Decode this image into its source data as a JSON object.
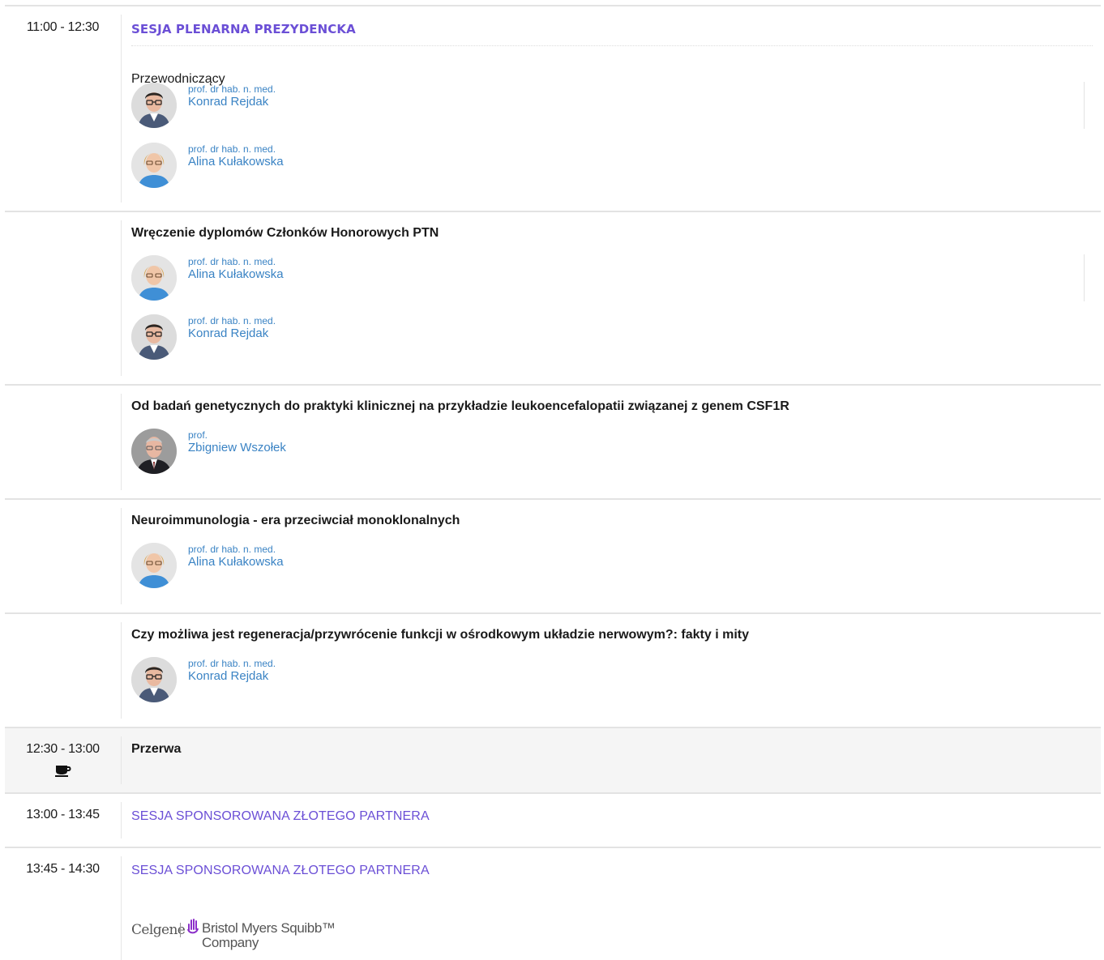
{
  "colors": {
    "session_title": "#6b4fd6",
    "speaker_link": "#3a83c4",
    "divider": "#e3e3e3",
    "break_bg": "#f5f5f5"
  },
  "rows": [
    {
      "time": "11:00 - 12:30",
      "session_title": "SESJA PLENARNA PREZYDENCKA",
      "role_label": "Przewodniczący",
      "speakers": [
        {
          "degree": "prof. dr hab. n. med.",
          "name": "Konrad Rejdak",
          "icon": "avatar-konrad-rejdak"
        },
        {
          "degree": "prof. dr hab. n. med.",
          "name": "Alina Kułakowska",
          "icon": "avatar-alina-kulakowska"
        }
      ]
    },
    {
      "talk_title": "Wręczenie dyplomów Członków Honorowych PTN",
      "speakers": [
        {
          "degree": "prof. dr hab. n. med.",
          "name": "Alina Kułakowska",
          "icon": "avatar-alina-kulakowska"
        },
        {
          "degree": "prof. dr hab. n. med.",
          "name": "Konrad Rejdak",
          "icon": "avatar-konrad-rejdak"
        }
      ]
    },
    {
      "talk_title": "Od badań genetycznych do praktyki klinicznej na przykładzie leukoencefalopatii związanej z genem CSF1R",
      "speakers": [
        {
          "degree": "prof.",
          "name": "Zbigniew Wszołek",
          "icon": "avatar-zbigniew-wszolek"
        }
      ]
    },
    {
      "talk_title": "Neuroimmunologia - era przeciwciał monoklonalnych",
      "speakers": [
        {
          "degree": "prof. dr hab. n. med.",
          "name": "Alina Kułakowska",
          "icon": "avatar-alina-kulakowska"
        }
      ]
    },
    {
      "talk_title": "Czy możliwa jest regeneracja/przywrócenie funkcji w ośrodkowym układzie nerwowym?: fakty i mity",
      "speakers": [
        {
          "degree": "prof. dr hab. n. med.",
          "name": "Konrad Rejdak",
          "icon": "avatar-konrad-rejdak"
        }
      ]
    },
    {
      "time": "12:30 - 13:00",
      "talk_title": "Przerwa",
      "icon": "coffee-cup-icon"
    },
    {
      "time": "13:00 - 13:45",
      "session_title": "SESJA SPONSOROWANA ZŁOTEGO PARTNERA"
    },
    {
      "time": "13:45 - 14:30",
      "session_title": "SESJA SPONSOROWANA ZŁOTEGO PARTNERA",
      "sponsor_logo": {
        "part1": "Celgene",
        "part2": "Bristol Myers Squibb™",
        "part3": "Company",
        "icon": "bms-hand-logo-icon"
      }
    }
  ]
}
